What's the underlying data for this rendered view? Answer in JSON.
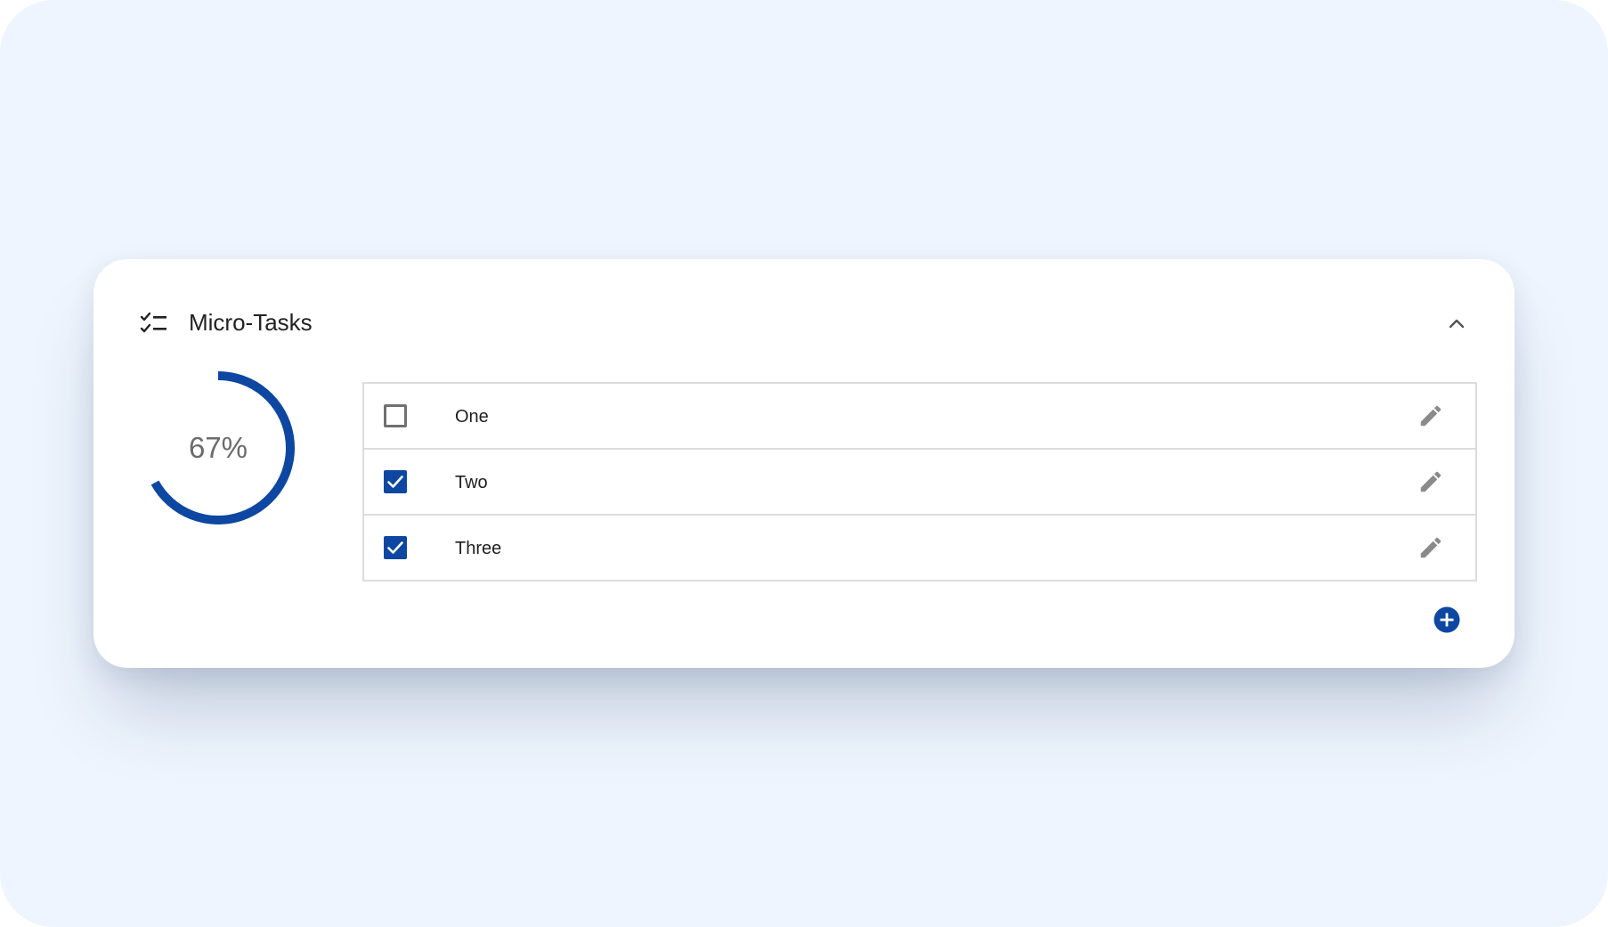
{
  "section": {
    "title": "Micro-Tasks",
    "header_icon": "checklist-icon",
    "collapse_icon": "chevron-up-icon"
  },
  "progress": {
    "label": "67%",
    "fraction": 0.67,
    "color": "#0d47a1"
  },
  "tasks": [
    {
      "label": "One",
      "checked": false,
      "edit_icon": "pencil-icon"
    },
    {
      "label": "Two",
      "checked": true,
      "edit_icon": "pencil-icon"
    },
    {
      "label": "Three",
      "checked": true,
      "edit_icon": "pencil-icon"
    }
  ],
  "add_button": {
    "icon": "plus-circle-icon",
    "color": "#0d47a1"
  },
  "colors": {
    "accent": "#0d47a1",
    "background": "#eef5fe",
    "card": "#ffffff",
    "icon_gray": "#8a8a8a"
  }
}
